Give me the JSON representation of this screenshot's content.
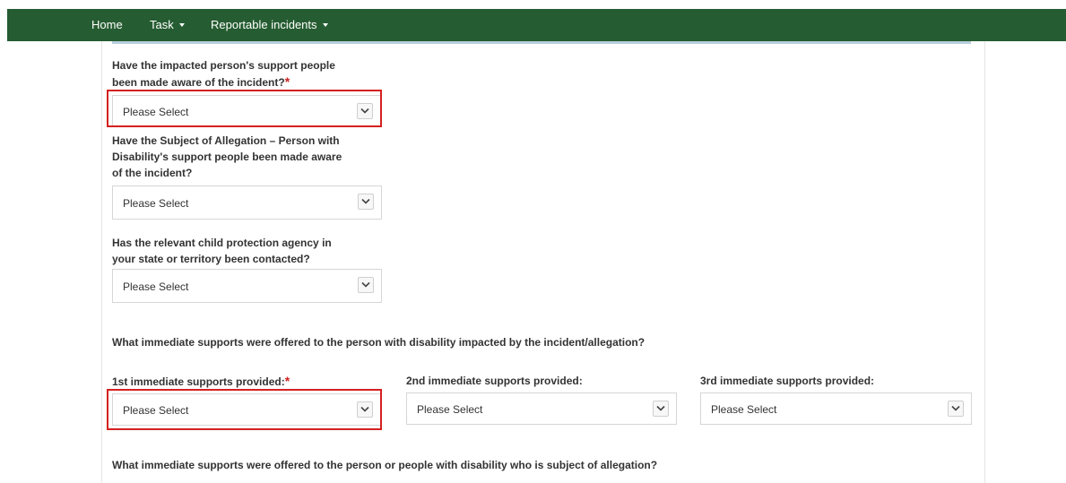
{
  "nav": {
    "home": "Home",
    "task": "Task",
    "reportable": "Reportable incidents"
  },
  "questions": {
    "q1": {
      "line1": "Have the impacted person's support people",
      "line2": "been made aware of the incident?",
      "required_mark": "*",
      "value": "Please Select"
    },
    "q2": {
      "line1": "Have the Subject of Allegation – Person with",
      "line2": "Disability's support people been made aware",
      "line3": "of the incident?",
      "value": "Please Select"
    },
    "q3": {
      "line1": "Has the relevant child protection agency in",
      "line2": "your state or territory been contacted?",
      "value": "Please Select"
    }
  },
  "immediate": {
    "heading": "What immediate supports were offered to the person with disability impacted by the incident/allegation?",
    "first_label": "1st immediate supports provided:",
    "first_required": "*",
    "first_value": "Please Select",
    "second_label": "2nd immediate supports provided:",
    "second_value": "Please Select",
    "third_label": "3rd immediate supports provided:",
    "third_value": "Please Select"
  },
  "subject": {
    "heading": "What immediate supports were offered to the person or people with disability who is subject of allegation?"
  },
  "colors": {
    "navbar": "#255c31",
    "highlight": "#d42020",
    "required": "#cc2222"
  },
  "icons": {
    "dropdown": "chevron-down-icon",
    "nav_caret": "caret-down-icon"
  }
}
